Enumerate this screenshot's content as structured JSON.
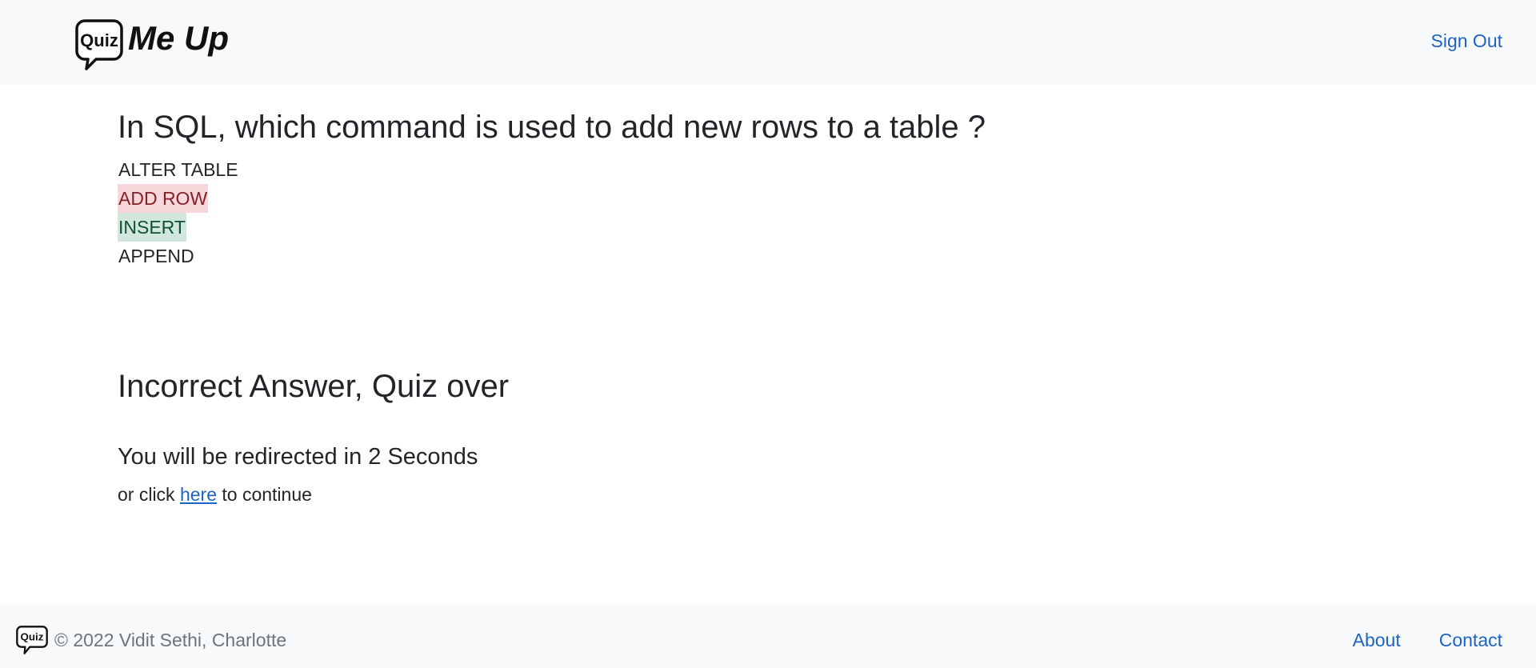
{
  "header": {
    "logo_text": "Quiz",
    "brand_name": "Me Up",
    "signout_label": "Sign Out"
  },
  "quiz": {
    "question": "In SQL, which command is used to add new rows to a table ?",
    "options": [
      {
        "label": "ALTER TABLE",
        "state": "neutral"
      },
      {
        "label": "ADD ROW",
        "state": "wrong"
      },
      {
        "label": "INSERT",
        "state": "correct"
      },
      {
        "label": "APPEND",
        "state": "neutral"
      }
    ]
  },
  "result": {
    "heading": "Incorrect Answer, Quiz over",
    "redirect_text": "You will be redirected in 2 Seconds",
    "continue_prefix": "or click ",
    "continue_link": "here",
    "continue_suffix": " to continue"
  },
  "footer": {
    "logo_text": "Quiz",
    "copyright": "© 2022 Vidit Sethi, Charlotte",
    "links": [
      "About",
      "Contact"
    ]
  },
  "colors": {
    "link": "#1e63c6",
    "wrong_bg": "#f8d7da",
    "correct_bg": "#d1e7dd",
    "bar_bg": "#f8f9fa"
  }
}
